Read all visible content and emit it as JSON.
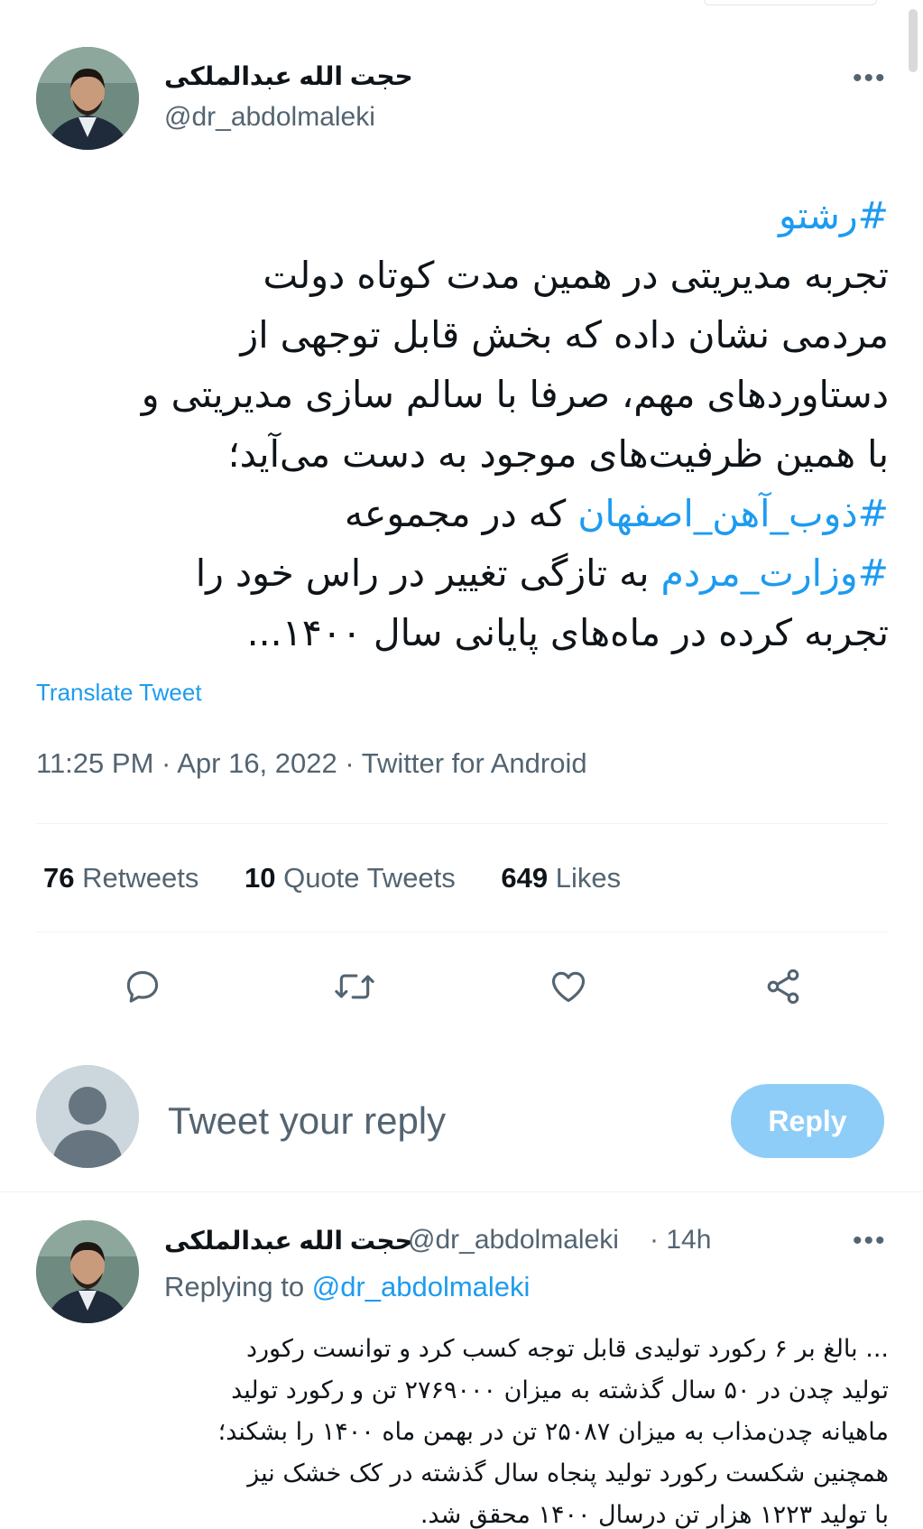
{
  "main_tweet": {
    "author_name": "حجت الله عبدالملکی",
    "author_handle": "@dr_abdolmaleki",
    "more_label": "•••",
    "body_lines": [
      {
        "parts": [
          {
            "text": "#رشتو",
            "tag": true
          }
        ]
      },
      {
        "parts": [
          {
            "text": "تجربه مدیریتی در همین مدت کوتاه دولت",
            "tag": false
          }
        ]
      },
      {
        "parts": [
          {
            "text": "مردمی نشان داده که بخش قابل توجهی از",
            "tag": false
          }
        ]
      },
      {
        "parts": [
          {
            "text": "دستاوردهای مهم، صرفا با سالم سازی مدیریتی و",
            "tag": false
          }
        ]
      },
      {
        "parts": [
          {
            "text": "با همین ظرفیت‌های موجود به دست می‌آید؛",
            "tag": false
          }
        ]
      },
      {
        "parts": [
          {
            "text": "#ذوب_آهن_اصفهان",
            "tag": true
          },
          {
            "text": " که در مجموعه",
            "tag": false
          }
        ]
      },
      {
        "parts": [
          {
            "text": "#وزارت_مردم",
            "tag": true
          },
          {
            "text": " به تازگی تغییر در راس خود را",
            "tag": false
          }
        ]
      },
      {
        "parts": [
          {
            "text": "تجربه کرده در ماه‌های پایانی سال ۱۴۰۰...",
            "tag": false
          }
        ]
      }
    ],
    "translate_label": "Translate Tweet",
    "meta": "11:25 PM · Apr 16, 2022 · Twitter for Android",
    "stats": {
      "retweets_count": "76",
      "retweets_label": "Retweets",
      "quotes_count": "10",
      "quotes_label": "Quote Tweets",
      "likes_count": "649",
      "likes_label": "Likes"
    },
    "actions": [
      {
        "icon": "reply-icon"
      },
      {
        "icon": "retweet-icon"
      },
      {
        "icon": "like-icon"
      },
      {
        "icon": "share-icon"
      }
    ]
  },
  "reply_box": {
    "placeholder": "Tweet your reply",
    "button_label": "Reply"
  },
  "reply_tweet": {
    "author_name": "حجت الله عبدالملکی",
    "author_handle": "@dr_abdolmaleki",
    "time": "· 14h",
    "more_label": "•••",
    "replying_prefix": "Replying to",
    "replying_handle": "@dr_abdolmaleki",
    "body_lines": [
      "... بالغ بر ۶ رکورد تولیدی قابل توجه کسب کرد و توانست رکورد",
      "تولید چدن در ۵۰ سال گذشته به میزان ۲۷۶۹۰۰۰ تن و رکورد تولید",
      "ماهیانه چدن‌مذاب به میزان ۲۵۰۸۷ تن در بهمن ماه ۱۴۰۰ را بشکند؛",
      "همچنین شکست رکورد تولید پنجاه سال گذشته در کک خشک نیز",
      "با تولید ۱۲۲۳ هزار تن درسال ۱۴۰۰ محقق شد."
    ]
  },
  "colors": {
    "accent": "#1d9bf0",
    "muted": "#536471",
    "reply_button": "#8ecdf8"
  }
}
